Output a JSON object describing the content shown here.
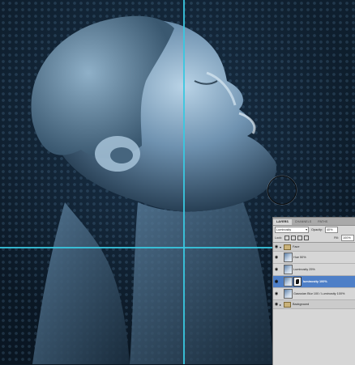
{
  "canvas": {
    "description_icon": "portrait-photo",
    "guide_color": "#38c8e0"
  },
  "layers_panel": {
    "tabs": [
      "LAYERS",
      "CHANNELS",
      "PATHS"
    ],
    "active_tab": "LAYERS",
    "blend_mode": "Luminosity",
    "opacity_label": "Opacity:",
    "opacity_value": "40%",
    "lock_label": "Lock:",
    "fill_label": "Fill:",
    "fill_value": "100%",
    "layers": [
      {
        "name": "Face",
        "type": "group"
      },
      {
        "name": "Hue 50%",
        "type": "layer"
      },
      {
        "name": "Luminosity 25%",
        "type": "layer"
      },
      {
        "name": "luminosity 100%",
        "type": "layer",
        "selected": true,
        "has_mask": true
      },
      {
        "name": "Gaussian Blur 100 / Luminosity 100%",
        "type": "layer"
      },
      {
        "name": "Background",
        "type": "group"
      }
    ]
  }
}
